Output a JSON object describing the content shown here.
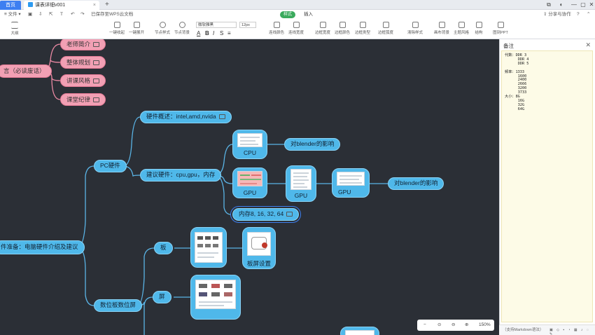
{
  "tabs": {
    "home": "首页",
    "doc": "课表详细v001",
    "plus": "+"
  },
  "window_buttons": [
    "⧉",
    "◐",
    "—",
    "▢",
    "✕"
  ],
  "menu": {
    "file": "≡ 文件 ▾",
    "saved_status": "已保存至WPS云文档",
    "style_tab": "样式",
    "insert_tab": "插入",
    "share": "分享与协作",
    "help": "?"
  },
  "toolbar": {
    "outline": "大纲",
    "collapse_one": "一键收起",
    "expand_one": "一键展开",
    "node_style": "节点样式",
    "node_bg": "节点背景",
    "font_name": "微软雅黑",
    "font_size": "12px",
    "line_color": "连线颜色",
    "line_width": "连线宽度",
    "border_width": "边框宽度",
    "border_color": "边框颜色",
    "border_type": "边框类型",
    "border_radius": "边框弧度",
    "clear_style": "清除样式",
    "canvas_bg": "画布背景",
    "theme": "主题风格",
    "structure": "结构",
    "to_ppt": "图到PPT"
  },
  "mindmap": {
    "pink_nodes": [
      "老师简介",
      "整体规划",
      "讲课风格",
      "课堂纪律"
    ],
    "left_root_top": "言（必读废话）",
    "left_root_bottom": "件准备：电脑硬件介绍及建议",
    "pc_hardware": "PC硬件",
    "hw_overview": "硬件概述：intel,amd,nvida",
    "hw_advice": "建议硬件：cpu,gpu，内存",
    "cpu": "CPU",
    "cpu_blender": "对blender的影响",
    "gpu1": "GPU",
    "gpu2": "GPU",
    "gpu3": "GPU",
    "gpu_blender": "对blender的影响",
    "memory": "内存8, 16, 32, 64",
    "tablet_screen": "数位板数位屏",
    "tablet": "板",
    "screen": "屏",
    "tablet_setting": "板屏设置"
  },
  "zoom": {
    "minus": "−",
    "fit": "⊙",
    "zoom_out": "⊖",
    "zoom_in": "⊕",
    "level": "150%"
  },
  "notes": {
    "title": "备注",
    "close": "✕",
    "content": "代数：DDR 3\n      DDR 4\n      DDR 5\n\n频率：1333\n      1600\n      2400\n      2666\n      3200\n      3733\n大小：8G\n      16G\n      32G\n      64G",
    "footer": "（支持Markdown语法）"
  },
  "colors": {
    "accent": "#3d7ff1",
    "pink": "#f2a0b4",
    "blue": "#4fb8ea",
    "canvas": "#2b2f36",
    "note_bg": "#fdfbe7",
    "style_green": "#3aaa5c"
  }
}
